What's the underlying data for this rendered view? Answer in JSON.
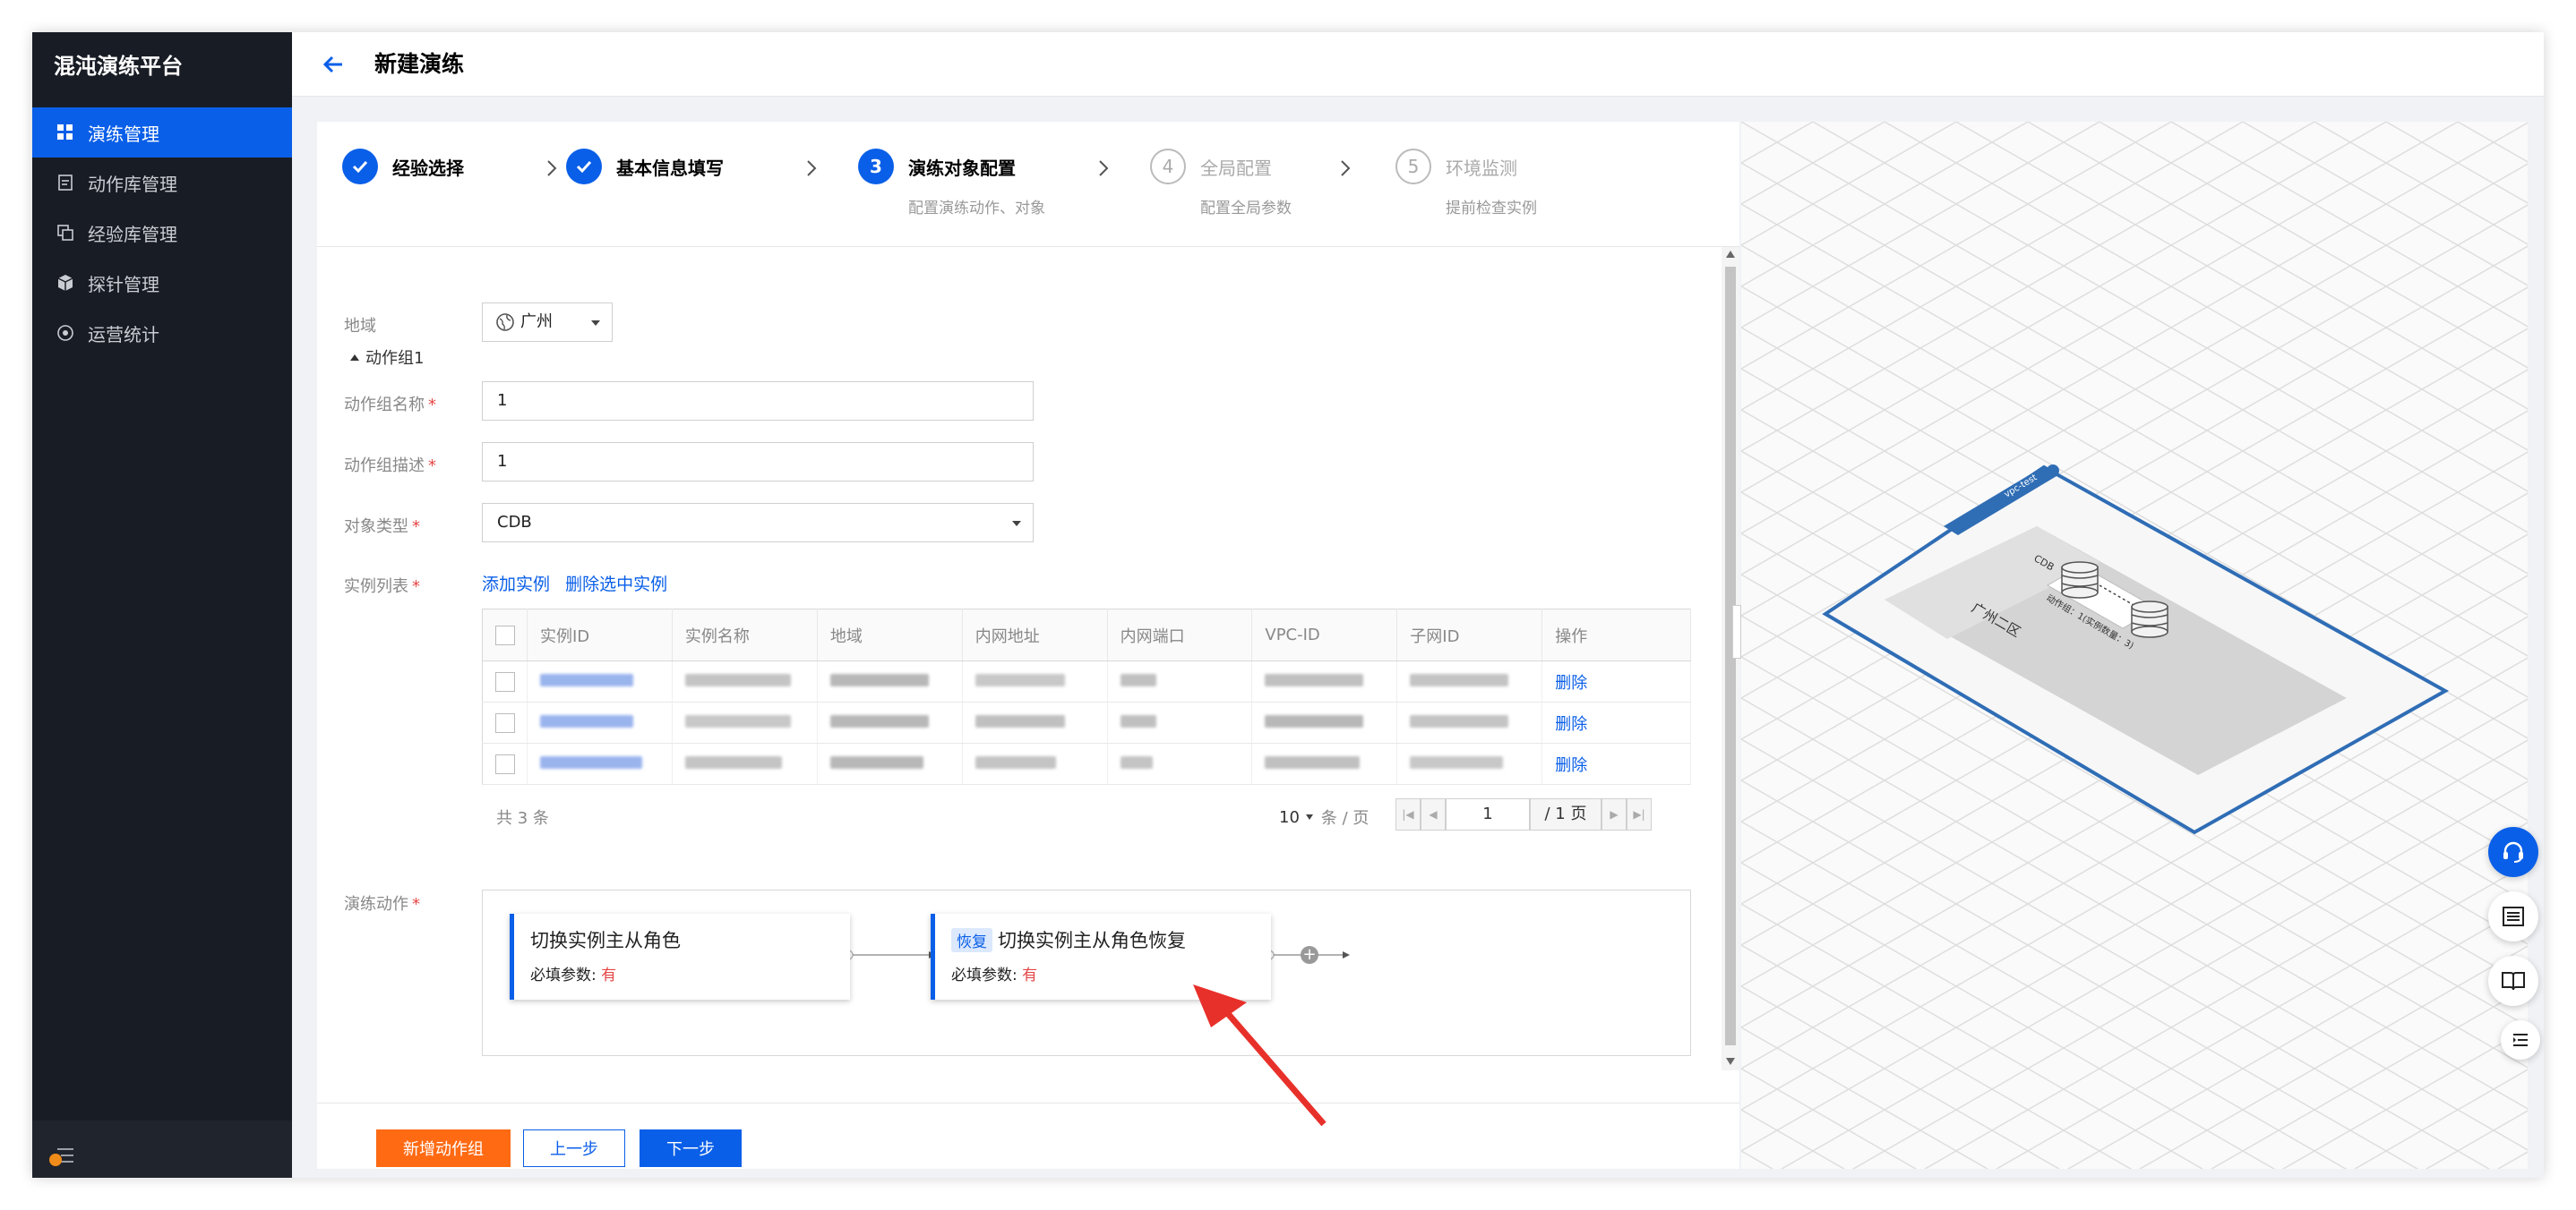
{
  "app": {
    "brand": "混沌演练平台"
  },
  "sidebar": {
    "items": [
      {
        "label": "演练管理",
        "icon": "grid-icon",
        "active": true
      },
      {
        "label": "动作库管理",
        "icon": "document-icon"
      },
      {
        "label": "经验库管理",
        "icon": "copy-icon"
      },
      {
        "label": "探针管理",
        "icon": "cube-icon"
      },
      {
        "label": "运营统计",
        "icon": "target-icon"
      }
    ]
  },
  "header": {
    "title": "新建演练"
  },
  "steps": [
    {
      "num": "1",
      "title": "经验选择",
      "sub": "",
      "state": "done"
    },
    {
      "num": "2",
      "title": "基本信息填写",
      "sub": "",
      "state": "done"
    },
    {
      "num": "3",
      "title": "演练对象配置",
      "sub": "配置演练动作、对象",
      "state": "current"
    },
    {
      "num": "4",
      "title": "全局配置",
      "sub": "配置全局参数",
      "state": "todo"
    },
    {
      "num": "5",
      "title": "环境监测",
      "sub": "提前检查实例",
      "state": "todo"
    }
  ],
  "form": {
    "region_label": "地域",
    "region_value": "广州",
    "group_title": "动作组1",
    "group_name_label": "动作组名称",
    "group_name_value": "1",
    "group_desc_label": "动作组描述",
    "group_desc_value": "1",
    "object_type_label": "对象类型",
    "object_type_value": "CDB",
    "instance_list_label": "实例列表",
    "add_instance": "添加实例",
    "delete_selected": "删除选中实例",
    "actions_label": "演练动作"
  },
  "table": {
    "columns": [
      "实例ID",
      "实例名称",
      "地域",
      "内网地址",
      "内网端口",
      "VPC-ID",
      "子网ID",
      "操作"
    ],
    "rows": [
      {
        "action": "删除"
      },
      {
        "action": "删除"
      },
      {
        "action": "删除"
      }
    ],
    "total": "共 3 条",
    "page_size": "10",
    "page_size_unit": "条 / 页",
    "page": "1",
    "page_total": "/ 1 页"
  },
  "flow": {
    "nodes": [
      {
        "tag": "",
        "title": "切换实例主从角色",
        "param_label": "必填参数:",
        "param_value": "有"
      },
      {
        "tag": "恢复",
        "title": "切换实例主从角色恢复",
        "param_label": "必填参数:",
        "param_value": "有"
      }
    ]
  },
  "buttons": {
    "new_group": "新增动作组",
    "prev": "上一步",
    "next": "下一步"
  },
  "topology": {
    "zone_label": "广州二区",
    "db_label": "CDB",
    "group_label": "动作组：1(实例数量：3)",
    "vpc_label": "vpc-test"
  },
  "colors": {
    "primary": "#0a5fe8",
    "sidebar_bg": "#181c24",
    "accent_orange": "#ff6a13",
    "danger": "#e54545",
    "annotation_arrow": "#e8302a",
    "topology_line": "#2f6db5"
  }
}
